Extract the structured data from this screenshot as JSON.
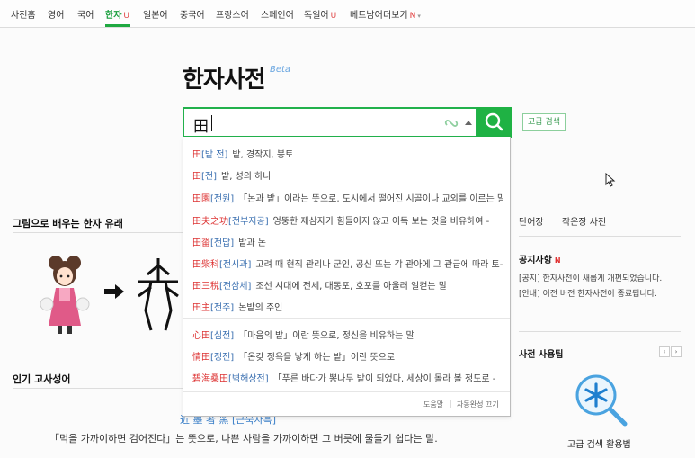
{
  "nav": {
    "items": [
      {
        "label": "사전홈",
        "badge": ""
      },
      {
        "label": "영어",
        "badge": ""
      },
      {
        "label": "국어",
        "badge": ""
      },
      {
        "label": "한자",
        "badge": "U"
      },
      {
        "label": "일본어",
        "badge": ""
      },
      {
        "label": "중국어",
        "badge": ""
      },
      {
        "label": "프랑스어",
        "badge": ""
      },
      {
        "label": "스페인어",
        "badge": ""
      },
      {
        "label": "독일어",
        "badge": "U"
      },
      {
        "label": "베트남어",
        "badge": ""
      },
      {
        "label": "더보기",
        "badge": "N"
      }
    ],
    "active": "한자",
    "accent_color": "#1fa941",
    "badge_u_color": "#e04848",
    "badge_n_color": "#e03030"
  },
  "page": {
    "title": "한자사전",
    "beta": "Beta"
  },
  "search": {
    "value": "田",
    "button_icon": "search-icon",
    "link_icon": "link-icon",
    "advanced_label": "고급 검색"
  },
  "suggestions": [
    {
      "hanja": "田",
      "reading": "[밭 전]",
      "meaning": "밭, 경작지, 봉토"
    },
    {
      "hanja": "田",
      "reading": "[전]",
      "meaning": "밭, 성의 하나"
    },
    {
      "hanja": "田園",
      "reading": "[전원]",
      "meaning": "「논과 밭」이라는 뜻으로, 도시에서 떨어진 시골이나 교외를 이르는 말"
    },
    {
      "hanja": "田夫之功",
      "reading": "[전부지공]",
      "meaning": "엉뚱한 제삼자가 힘들이지 않고 이득 보는 것을 비유하여 -"
    },
    {
      "hanja": "田畓",
      "reading": "[전답]",
      "meaning": "밭과 논"
    },
    {
      "hanja": "田柴科",
      "reading": "[전시과]",
      "meaning": "고려 때 현직 관리나 군인, 공신 또는 각 관아에 그 관급에 따라 토-"
    },
    {
      "hanja": "田三稅",
      "reading": "[전삼세]",
      "meaning": "조선 시대에 전세, 대동포, 호포를 아울러 일컫는 말"
    },
    {
      "hanja": "田主",
      "reading": "[전주]",
      "meaning": "논밭의 주인"
    },
    {
      "hanja": "心田",
      "reading": "[심전]",
      "meaning": "「마음의 밭」이란 뜻으로, 정신을 비유하는 말"
    },
    {
      "hanja": "情田",
      "reading": "[정전]",
      "meaning": "「온갖 정욕을 낳게 하는 밭」이란 뜻으로"
    },
    {
      "hanja": "碧海桑田",
      "reading": "[벽해상전]",
      "meaning": "「푸른 바다가 뽕나무 밭이 되었다, 세상이 몰라 볼 정도로 -"
    }
  ],
  "dropdown_footer": {
    "help": "도움말",
    "autocomplete_off": "자동완성 끄기"
  },
  "left": {
    "section1": "그림으로 배우는 한자 유래",
    "section2": "인기 고사성어",
    "idiom_partial": "近 墨 者 黑  [근묵자흑]",
    "idiom_desc": "「먹을 가까이하면 검어진다」는 뜻으로, 나쁜 사람을 가까이하면 그 버릇에 물들기 쉽다는 말."
  },
  "right": {
    "link1": "단어장",
    "link2": "작은장 사전",
    "notice_title": "공지사항",
    "notice_badge": "N",
    "notices": [
      "[공지] 한자사전이 새롭게 개편되었습니다.",
      "[안내] 이전 버전 한자사전이 종료됩니다."
    ],
    "tips_title": "사전 사용팁",
    "prev": "‹",
    "next": "›",
    "tips_caption": "고급 검색 활용법"
  }
}
